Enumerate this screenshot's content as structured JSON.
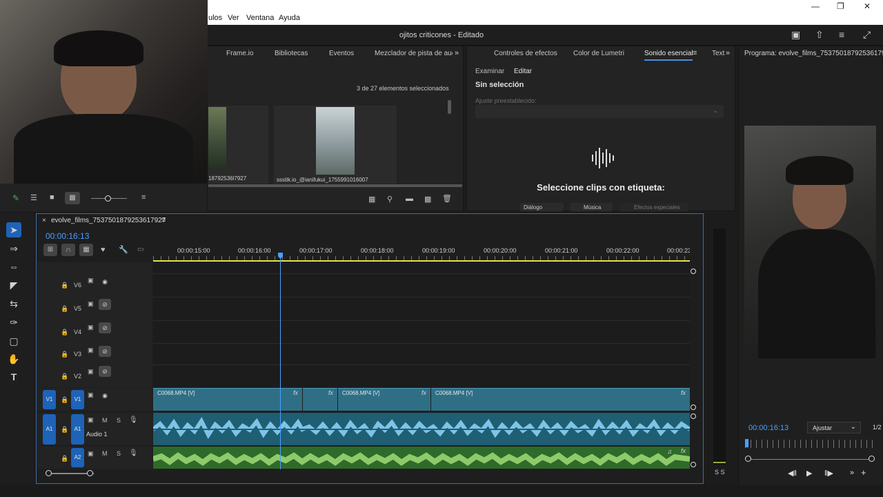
{
  "menu": {
    "items": [
      "ulos",
      "Ver",
      "Ventana",
      "Ayuda"
    ]
  },
  "window": {
    "title": "ojitos criticones - Editado"
  },
  "project_tabs": [
    "Frame.io",
    "Bibliotecas",
    "Eventos",
    "Mezclador de pista de audic"
  ],
  "project": {
    "selection_status": "3 de 27 elementos seleccionados",
    "items": [
      {
        "name": "18792536l7927"
      },
      {
        "name": "ssstik.io_@ianifukui_1755991016007"
      }
    ]
  },
  "effects_tabs": [
    "Controles de efectos",
    "Color de Lumetri",
    "Sonido esencial",
    "Text"
  ],
  "essential_sound": {
    "subtabs": [
      "Examinar",
      "Editar"
    ],
    "status": "Sin selección",
    "preset_label": "Ajuste preestablecido:",
    "prompt": "Seleccione clips con etiqueta:",
    "types": [
      "Diálogo",
      "Música",
      "Efectos especiales"
    ]
  },
  "program": {
    "title": "Programa: evolve_films_7537501879253617927",
    "timecode": "00:00:16:13",
    "fit": "Ajustar",
    "ratio": "1/2"
  },
  "timeline": {
    "sequence_name": "evolve_films_7537501879253617927",
    "timecode": "00:00:16:13",
    "ruler": [
      "00:00:15:00",
      "00:00:16:00",
      "00:00:17:00",
      "00:00:18:00",
      "00:00:19:00",
      "00:00:20:00",
      "00:00:21:00",
      "00:00:22:00",
      "00:00:23"
    ],
    "video_tracks": [
      "V6",
      "V5",
      "V4",
      "V3",
      "V2",
      "V1"
    ],
    "audio_tracks": [
      "A1",
      "A2"
    ],
    "audio1_name": "Audio 1",
    "source_v1": "V1",
    "source_a1": "A1",
    "clips": [
      "C0068.MP4 [V]",
      "C0068.MP4 [V]",
      "C0068.MP4 [V]"
    ],
    "fx_label": "fx",
    "ms_m": "M",
    "ms_s": "S"
  },
  "meter": {
    "labels": "S S"
  },
  "colors": {
    "accent": "#2d8ceb",
    "clip_video": "#2f6f86",
    "audio_wave": "#7dc4e6",
    "audio2_wave": "#8fca6a",
    "playhead": "#4aa0ff"
  }
}
